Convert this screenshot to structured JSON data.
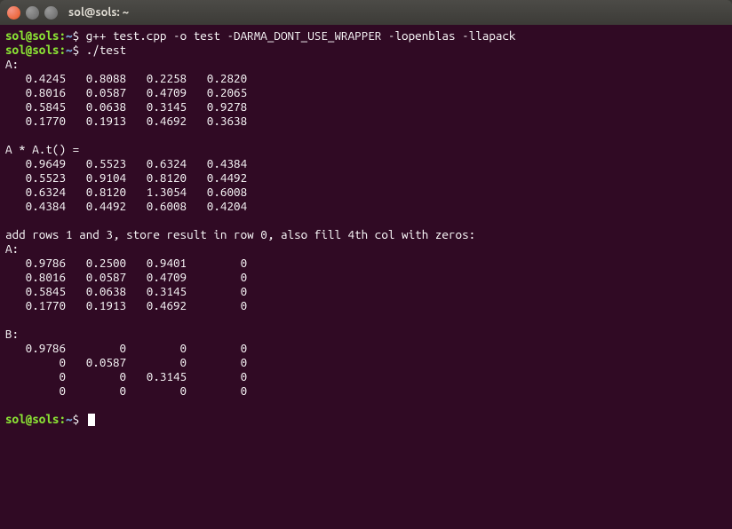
{
  "window": {
    "title": "sol@sols: ~"
  },
  "prompt": {
    "user_host": "sol@sols",
    "sep": ":",
    "path": "~",
    "symbol": "$"
  },
  "commands": {
    "line1": "g++ test.cpp -o test -DARMA_DONT_USE_WRAPPER -lopenblas -llapack",
    "line2": "./test"
  },
  "output": {
    "A_label": "A:",
    "A": [
      "   0.4245   0.8088   0.2258   0.2820",
      "   0.8016   0.0587   0.4709   0.2065",
      "   0.5845   0.0638   0.3145   0.9278",
      "   0.1770   0.1913   0.4692   0.3638"
    ],
    "AAt_label": "A * A.t() = ",
    "AAt": [
      "   0.9649   0.5523   0.6324   0.4384",
      "   0.5523   0.9104   0.8120   0.4492",
      "   0.6324   0.8120   1.3054   0.6008",
      "   0.4384   0.4492   0.6008   0.4204"
    ],
    "addrows_label": "add rows 1 and 3, store result in row 0, also fill 4th col with zeros:",
    "A2_label": "A:",
    "A2": [
      "   0.9786   0.2500   0.9401        0",
      "   0.8016   0.0587   0.4709        0",
      "   0.5845   0.0638   0.3145        0",
      "   0.1770   0.1913   0.4692        0"
    ],
    "B_label": "B:",
    "B": [
      "   0.9786        0        0        0",
      "        0   0.0587        0        0",
      "        0        0   0.3145        0",
      "        0        0        0        0"
    ]
  }
}
